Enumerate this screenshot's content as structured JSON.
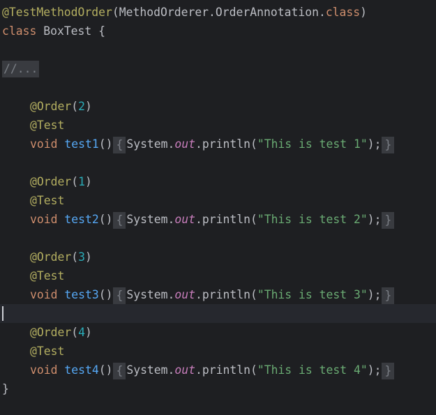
{
  "code": {
    "header": {
      "annotation": "@TestMethodOrder",
      "open_paren": "(",
      "arg_class": "MethodOrderer.OrderAnnotation.",
      "arg_keyword": "class",
      "close_paren": ")"
    },
    "class_decl": {
      "keyword": "class",
      "name": " BoxTest {"
    },
    "folded_comment": "//...",
    "methods": [
      {
        "order_annotation": "@Order",
        "open_paren": "(",
        "order_value": "2",
        "close_paren": ")",
        "test_annotation": "@Test",
        "return_type": "void",
        "name": "test1",
        "parens": "()",
        "open_brace": "{",
        "system": "System.",
        "out": "out",
        "println": ".println(",
        "string": "\"This is test 1\"",
        "close_call": ");",
        "close_brace": "}"
      },
      {
        "order_annotation": "@Order",
        "open_paren": "(",
        "order_value": "1",
        "close_paren": ")",
        "test_annotation": "@Test",
        "return_type": "void",
        "name": "test2",
        "parens": "()",
        "open_brace": "{",
        "system": "System.",
        "out": "out",
        "println": ".println(",
        "string": "\"This is test 2\"",
        "close_call": ");",
        "close_brace": "}"
      },
      {
        "order_annotation": "@Order",
        "open_paren": "(",
        "order_value": "3",
        "close_paren": ")",
        "test_annotation": "@Test",
        "return_type": "void",
        "name": "test3",
        "parens": "()",
        "open_brace": "{",
        "system": "System.",
        "out": "out",
        "println": ".println(",
        "string": "\"This is test 3\"",
        "close_call": ");",
        "close_brace": "}"
      },
      {
        "order_annotation": "@Order",
        "open_paren": "(",
        "order_value": "4",
        "close_paren": ")",
        "test_annotation": "@Test",
        "return_type": "void",
        "name": "test4",
        "parens": "()",
        "open_brace": "{",
        "system": "System.",
        "out": "out",
        "println": ".println(",
        "string": "\"This is test 4\"",
        "close_call": ");",
        "close_brace": "}"
      }
    ],
    "class_close": "}"
  },
  "colors": {
    "background": "#1e1f22",
    "annotation": "#b3ae60",
    "keyword": "#cf8e6d",
    "function": "#56a8f5",
    "number": "#2aacb8",
    "string": "#6aab73",
    "field": "#c77dbb",
    "text": "#bcbec4"
  }
}
